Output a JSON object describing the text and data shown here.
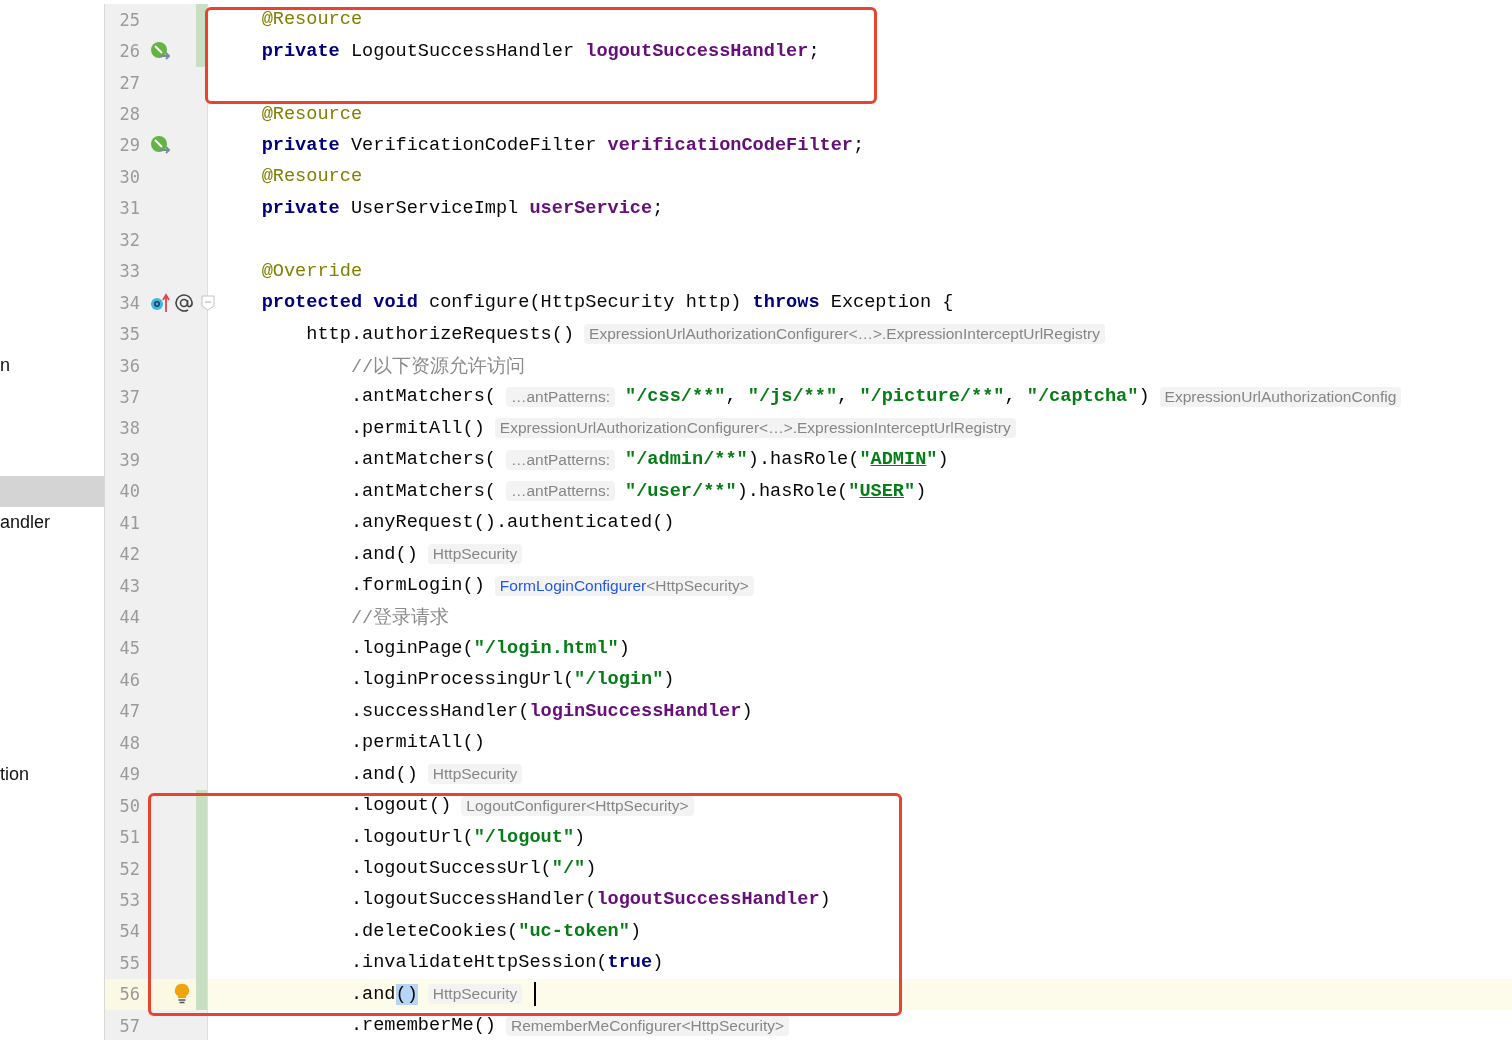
{
  "blocks": [
    {
      "framed": true,
      "lines": [
        {
          "number": "25",
          "changed": true,
          "tokens": [
            {
              "kind": "annotation",
              "text": "    @Resource"
            }
          ]
        },
        {
          "number": "26",
          "changed": true,
          "gutter_icons": [
            {
              "kind": "bean"
            }
          ],
          "tokens": [
            {
              "kind": "keyword",
              "text": "    private"
            },
            {
              "kind": "plain",
              "text": " LogoutSuccessHandler "
            },
            {
              "kind": "field",
              "text": "logoutSuccessHandler"
            },
            {
              "kind": "plain",
              "text": ";"
            }
          ]
        },
        {
          "number": "27"
        }
      ]
    },
    {
      "framed": false,
      "lines": [
        {
          "number": "28",
          "tokens": [
            {
              "kind": "annotation",
              "text": "    @Resource"
            }
          ]
        },
        {
          "number": "29",
          "gutter_icons": [
            {
              "kind": "bean"
            }
          ],
          "tokens": [
            {
              "kind": "keyword",
              "text": "    private"
            },
            {
              "kind": "plain",
              "text": " VerificationCodeFilter "
            },
            {
              "kind": "field",
              "text": "verificationCodeFilter"
            },
            {
              "kind": "plain",
              "text": ";"
            }
          ]
        },
        {
          "number": "30",
          "tokens": [
            {
              "kind": "annotation",
              "text": "    @Resource"
            }
          ]
        },
        {
          "number": "31",
          "tokens": [
            {
              "kind": "keyword",
              "text": "    private"
            },
            {
              "kind": "plain",
              "text": " UserServiceImpl "
            },
            {
              "kind": "field",
              "text": "userService"
            },
            {
              "kind": "plain",
              "text": ";"
            }
          ]
        },
        {
          "number": "32"
        },
        {
          "number": "33",
          "tokens": [
            {
              "kind": "annotation",
              "text": "    @Override"
            }
          ]
        },
        {
          "number": "34",
          "gutter_icons": [
            {
              "kind": "override"
            },
            {
              "kind": "annotation"
            }
          ],
          "fold": true,
          "tokens": [
            {
              "kind": "keyword",
              "text": "    protected"
            },
            {
              "kind": "keyword",
              "text": " void"
            },
            {
              "kind": "plain",
              "text": " configure(HttpSecurity http) "
            },
            {
              "kind": "keyword",
              "text": "throws"
            },
            {
              "kind": "plain",
              "text": " Exception {"
            }
          ]
        },
        {
          "number": "35",
          "tokens": [
            {
              "kind": "plain",
              "text": "        http.authorizeRequests()"
            },
            {
              "kind": "hint",
              "text": "ExpressionUrlAuthorizationConfigurer<…>.ExpressionInterceptUrlRegistry"
            }
          ]
        },
        {
          "number": "36",
          "side": {
            "text": "n",
            "selected": false
          },
          "tokens": [
            {
              "kind": "comment",
              "text": "            //以下资源允许访问"
            }
          ]
        },
        {
          "number": "37",
          "tokens": [
            {
              "kind": "plain",
              "text": "            .antMatchers("
            },
            {
              "kind": "hint",
              "text": "…antPatterns:"
            },
            {
              "kind": "string",
              "text": "\"/css/**\""
            },
            {
              "kind": "plain",
              "text": ", "
            },
            {
              "kind": "string",
              "text": "\"/js/**\""
            },
            {
              "kind": "plain",
              "text": ", "
            },
            {
              "kind": "string",
              "text": "\"/picture/**\""
            },
            {
              "kind": "plain",
              "text": ", "
            },
            {
              "kind": "string",
              "text": "\"/captcha\""
            },
            {
              "kind": "plain",
              "text": ")"
            },
            {
              "kind": "hint",
              "text": "ExpressionUrlAuthorizationConfig"
            }
          ]
        },
        {
          "number": "38",
          "tokens": [
            {
              "kind": "plain",
              "text": "            .permitAll()"
            },
            {
              "kind": "hint",
              "text": "ExpressionUrlAuthorizationConfigurer<…>.ExpressionInterceptUrlRegistry"
            }
          ]
        },
        {
          "number": "39",
          "tokens": [
            {
              "kind": "plain",
              "text": "            .antMatchers("
            },
            {
              "kind": "hint",
              "text": "…antPatterns:"
            },
            {
              "kind": "string",
              "text": "\"/admin/**\""
            },
            {
              "kind": "plain",
              "text": ").hasRole("
            },
            {
              "kind": "string",
              "text": "\""
            },
            {
              "kind": "string_link",
              "text": "ADMIN"
            },
            {
              "kind": "string",
              "text": "\""
            },
            {
              "kind": "plain",
              "text": ")"
            }
          ]
        },
        {
          "number": "40",
          "side": {
            "selected": true
          },
          "tokens": [
            {
              "kind": "plain",
              "text": "            .antMatchers("
            },
            {
              "kind": "hint",
              "text": "…antPatterns:"
            },
            {
              "kind": "string",
              "text": "\"/user/**\""
            },
            {
              "kind": "plain",
              "text": ").hasRole("
            },
            {
              "kind": "string",
              "text": "\""
            },
            {
              "kind": "string_link",
              "text": "USER"
            },
            {
              "kind": "string",
              "text": "\""
            },
            {
              "kind": "plain",
              "text": ")"
            }
          ]
        },
        {
          "number": "41",
          "side": {
            "text": "andler",
            "selected": false
          },
          "tokens": [
            {
              "kind": "plain",
              "text": "            .anyRequest().authenticated()"
            }
          ]
        },
        {
          "number": "42",
          "tokens": [
            {
              "kind": "plain",
              "text": "            .and()"
            },
            {
              "kind": "hint",
              "text": "HttpSecurity"
            }
          ]
        },
        {
          "number": "43",
          "tokens": [
            {
              "kind": "plain",
              "text": "            .formLogin()"
            },
            {
              "kind": "hint",
              "link": "FormLoginConfigurer",
              "text": "<HttpSecurity>"
            }
          ]
        },
        {
          "number": "44",
          "tokens": [
            {
              "kind": "comment",
              "text": "            //登录请求"
            }
          ]
        },
        {
          "number": "45",
          "tokens": [
            {
              "kind": "plain",
              "text": "            .loginPage("
            },
            {
              "kind": "string",
              "text": "\"/login.html\""
            },
            {
              "kind": "plain",
              "text": ")"
            }
          ]
        },
        {
          "number": "46",
          "tokens": [
            {
              "kind": "plain",
              "text": "            .loginProcessingUrl("
            },
            {
              "kind": "string",
              "text": "\"/login\""
            },
            {
              "kind": "plain",
              "text": ")"
            }
          ]
        },
        {
          "number": "47",
          "tokens": [
            {
              "kind": "plain",
              "text": "            .successHandler("
            },
            {
              "kind": "field",
              "text": "loginSuccessHandler"
            },
            {
              "kind": "plain",
              "text": ")"
            }
          ]
        },
        {
          "number": "48",
          "tokens": [
            {
              "kind": "plain",
              "text": "            .permitAll()"
            }
          ]
        },
        {
          "number": "49",
          "side": {
            "text": "tion",
            "selected": false
          },
          "tokens": [
            {
              "kind": "plain",
              "text": "            .and()"
            },
            {
              "kind": "hint",
              "text": "HttpSecurity"
            }
          ]
        }
      ]
    },
    {
      "framed": true,
      "lines": [
        {
          "number": "50",
          "changed": true,
          "tokens": [
            {
              "kind": "plain",
              "text": "            .logout()"
            },
            {
              "kind": "hint",
              "text": "LogoutConfigurer<HttpSecurity>"
            }
          ]
        },
        {
          "number": "51",
          "changed": true,
          "tokens": [
            {
              "kind": "plain",
              "text": "            .logoutUrl("
            },
            {
              "kind": "string",
              "text": "\"/logout\""
            },
            {
              "kind": "plain",
              "text": ")"
            }
          ]
        },
        {
          "number": "52",
          "changed": true,
          "tokens": [
            {
              "kind": "plain",
              "text": "            .logoutSuccessUrl("
            },
            {
              "kind": "string",
              "text": "\"/\""
            },
            {
              "kind": "plain",
              "text": ")"
            }
          ]
        },
        {
          "number": "53",
          "changed": true,
          "tokens": [
            {
              "kind": "plain",
              "text": "            .logoutSuccessHandler("
            },
            {
              "kind": "field",
              "text": "logoutSuccessHandler"
            },
            {
              "kind": "plain",
              "text": ")"
            }
          ]
        },
        {
          "number": "54",
          "changed": true,
          "tokens": [
            {
              "kind": "plain",
              "text": "            .deleteCookies("
            },
            {
              "kind": "string",
              "text": "\"uc-token\""
            },
            {
              "kind": "plain",
              "text": ")"
            }
          ]
        },
        {
          "number": "55",
          "changed": true,
          "tokens": [
            {
              "kind": "plain",
              "text": "            .invalidateHttpSession("
            },
            {
              "kind": "keyword",
              "text": "true"
            },
            {
              "kind": "plain",
              "text": ")"
            }
          ]
        },
        {
          "number": "56",
          "changed": true,
          "current": true,
          "caret": true,
          "gutter_icons": [
            {
              "kind": "bulb"
            }
          ],
          "tokens": [
            {
              "kind": "plain",
              "text": "            .and"
            },
            {
              "kind": "match",
              "text": "()"
            },
            {
              "kind": "hint",
              "text": "HttpSecurity"
            }
          ]
        }
      ]
    },
    {
      "framed": false,
      "lines": [
        {
          "number": "57",
          "tokens": [
            {
              "kind": "plain",
              "text": "            .rememberMe()"
            },
            {
              "kind": "hint",
              "text": "RememberMeConfigurer<HttpSecurity>"
            }
          ]
        }
      ]
    }
  ]
}
